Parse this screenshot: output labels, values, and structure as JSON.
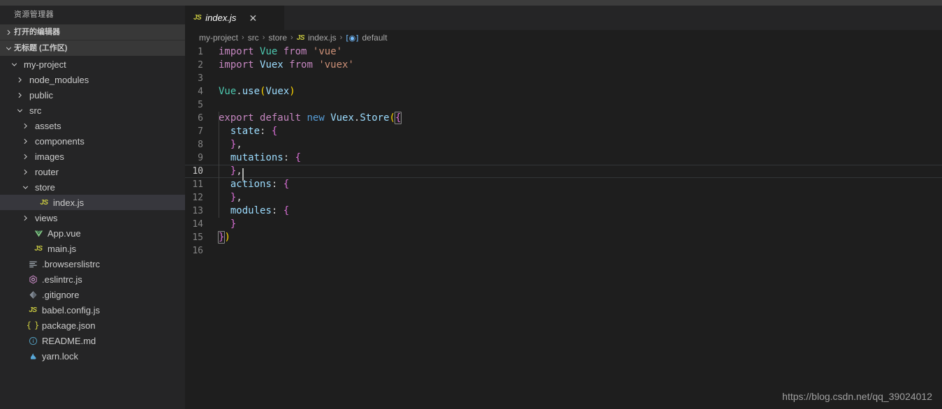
{
  "sidebar": {
    "title": "资源管理器",
    "sections": [
      {
        "label": "打开的编辑器",
        "expanded": false,
        "icon": "chevron-right-icon"
      },
      {
        "label": "无标题 (工作区)",
        "expanded": true,
        "icon": "chevron-down-icon"
      }
    ],
    "tree": [
      {
        "label": "my-project",
        "depth": 1,
        "twisty": "chevron-down-icon",
        "icon": "",
        "selected": false
      },
      {
        "label": "node_modules",
        "depth": 2,
        "twisty": "chevron-right-icon",
        "icon": "",
        "selected": false
      },
      {
        "label": "public",
        "depth": 2,
        "twisty": "chevron-right-icon",
        "icon": "",
        "selected": false
      },
      {
        "label": "src",
        "depth": 2,
        "twisty": "chevron-down-icon",
        "icon": "",
        "selected": false
      },
      {
        "label": "assets",
        "depth": 3,
        "twisty": "chevron-right-icon",
        "icon": "",
        "selected": false
      },
      {
        "label": "components",
        "depth": 3,
        "twisty": "chevron-right-icon",
        "icon": "",
        "selected": false
      },
      {
        "label": "images",
        "depth": 3,
        "twisty": "chevron-right-icon",
        "icon": "",
        "selected": false
      },
      {
        "label": "router",
        "depth": 3,
        "twisty": "chevron-right-icon",
        "icon": "",
        "selected": false
      },
      {
        "label": "store",
        "depth": 3,
        "twisty": "chevron-down-icon",
        "icon": "",
        "selected": false
      },
      {
        "label": "index.js",
        "depth": 4,
        "twisty": "",
        "icon": "js-file-icon",
        "selected": true
      },
      {
        "label": "views",
        "depth": 3,
        "twisty": "chevron-right-icon",
        "icon": "",
        "selected": false
      },
      {
        "label": "App.vue",
        "depth": 3,
        "twisty": "",
        "icon": "vue-file-icon",
        "selected": false
      },
      {
        "label": "main.js",
        "depth": 3,
        "twisty": "",
        "icon": "js-file-icon",
        "selected": false
      },
      {
        "label": ".browserslistrc",
        "depth": 2,
        "twisty": "",
        "icon": "config-list-icon",
        "selected": false
      },
      {
        "label": ".eslintrc.js",
        "depth": 2,
        "twisty": "",
        "icon": "eslint-icon",
        "selected": false
      },
      {
        "label": ".gitignore",
        "depth": 2,
        "twisty": "",
        "icon": "git-icon",
        "selected": false
      },
      {
        "label": "babel.config.js",
        "depth": 2,
        "twisty": "",
        "icon": "js-file-icon",
        "selected": false
      },
      {
        "label": "package.json",
        "depth": 2,
        "twisty": "",
        "icon": "json-file-icon",
        "selected": false
      },
      {
        "label": "README.md",
        "depth": 2,
        "twisty": "",
        "icon": "markdown-file-icon",
        "selected": false
      },
      {
        "label": "yarn.lock",
        "depth": 2,
        "twisty": "",
        "icon": "yarn-file-icon",
        "selected": false
      }
    ]
  },
  "tabs": [
    {
      "label": "index.js",
      "icon": "js-file-icon",
      "active": true,
      "preview": true,
      "close": "✕"
    }
  ],
  "breadcrumb": [
    {
      "label": "my-project",
      "icon": ""
    },
    {
      "label": "src",
      "icon": ""
    },
    {
      "label": "store",
      "icon": ""
    },
    {
      "label": "index.js",
      "icon": "js-file-icon"
    },
    {
      "label": "default",
      "icon": "symbol-variable-icon"
    }
  ],
  "breadcrumb_separator": "›",
  "code": {
    "language": "javascript",
    "lines": [
      {
        "n": "1",
        "text": "import Vue from 'vue'"
      },
      {
        "n": "2",
        "text": "import Vuex from 'vuex'"
      },
      {
        "n": "3",
        "text": ""
      },
      {
        "n": "4",
        "text": "Vue.use(Vuex)"
      },
      {
        "n": "5",
        "text": ""
      },
      {
        "n": "6",
        "text": "export default new Vuex.Store({"
      },
      {
        "n": "7",
        "text": "  state: {"
      },
      {
        "n": "8",
        "text": "  },"
      },
      {
        "n": "9",
        "text": "  mutations: {"
      },
      {
        "n": "10",
        "text": "  },"
      },
      {
        "n": "11",
        "text": "  actions: {"
      },
      {
        "n": "12",
        "text": "  },"
      },
      {
        "n": "13",
        "text": "  modules: {"
      },
      {
        "n": "14",
        "text": "  }"
      },
      {
        "n": "15",
        "text": "})"
      },
      {
        "n": "16",
        "text": ""
      }
    ],
    "active_line": "10",
    "cursor_line": 10,
    "cursor_column": 5
  },
  "watermark": "https://blog.csdn.net/qq_39024012",
  "colors": {
    "editor_bg": "#1e1e1e",
    "sidebar_bg": "#252526",
    "section_header_bg": "#383838",
    "selection_bg": "#37373d",
    "keyword": "#c586c0",
    "keyword_blue": "#569cd6",
    "type": "#4ec9b0",
    "variable": "#9cdcfe",
    "string": "#ce9178",
    "function": "#dcdcaa",
    "bracket1": "#ffd700",
    "bracket2": "#da70d6",
    "line_number": "#858585",
    "js_icon": "#cbcb41",
    "vue_icon": "#81c784"
  }
}
